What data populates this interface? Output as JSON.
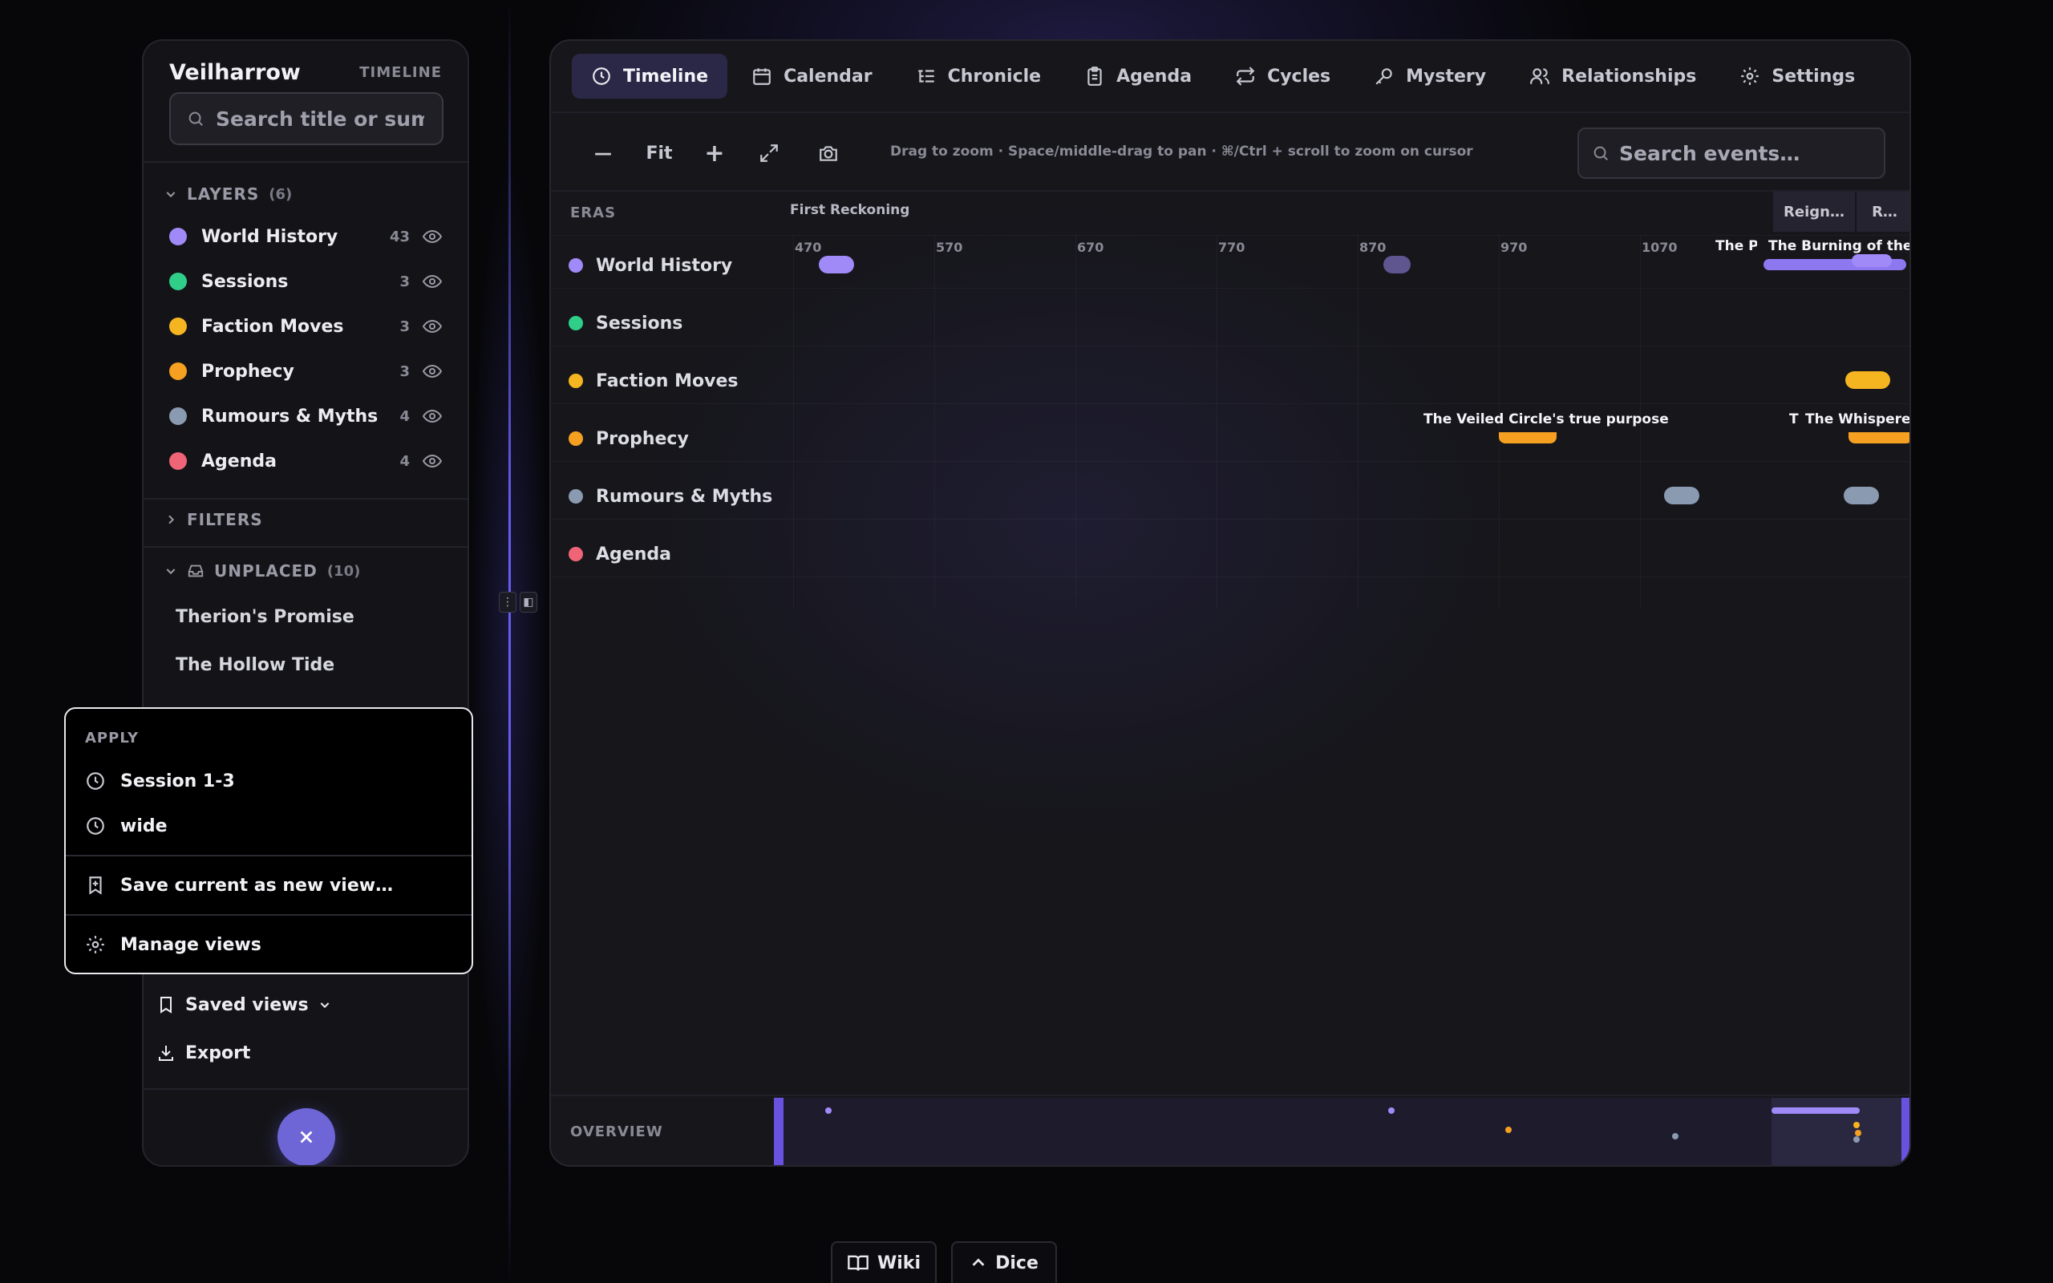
{
  "sidebar": {
    "title": "Veilharrow",
    "subtitle": "TIMELINE",
    "search_placeholder": "Search title or summary",
    "layers_heading": "LAYERS",
    "layers_count": "(6)",
    "layers": [
      {
        "name": "World History",
        "count": "43",
        "color": "#a08af8"
      },
      {
        "name": "Sessions",
        "count": "3",
        "color": "#2fcf8a"
      },
      {
        "name": "Faction Moves",
        "count": "3",
        "color": "#f5b520"
      },
      {
        "name": "Prophecy",
        "count": "3",
        "color": "#f5a020"
      },
      {
        "name": "Rumours & Myths",
        "count": "4",
        "color": "#8a9ab0"
      },
      {
        "name": "Agenda",
        "count": "4",
        "color": "#f06478"
      }
    ],
    "filters_heading": "FILTERS",
    "unplaced_heading": "UNPLACED",
    "unplaced_count": "(10)",
    "unplaced_items": [
      "Therion's Promise",
      "The Hollow Tide"
    ],
    "saved_views_label": "Saved views",
    "export_label": "Export"
  },
  "popup": {
    "apply_label": "APPLY",
    "views": [
      "Session 1-3",
      "wide"
    ],
    "save_label": "Save current as new view…",
    "manage_label": "Manage views"
  },
  "tabs": [
    "Timeline",
    "Calendar",
    "Chronicle",
    "Agenda",
    "Cycles",
    "Mystery",
    "Relationships",
    "Settings"
  ],
  "toolbar": {
    "zoom_out": "—",
    "fit": "Fit",
    "zoom_in": "+",
    "hint": "Drag to zoom · Space/middle-drag to pan · ⌘/Ctrl + scroll to zoom on cursor",
    "search_placeholder": "Search events…"
  },
  "timeline": {
    "eras_label": "ERAS",
    "eras": [
      "First Reckoning",
      "Reign…",
      "R…"
    ],
    "ticks": [
      "470",
      "570",
      "670",
      "770",
      "870",
      "970",
      "1070"
    ],
    "lanes": [
      "World History",
      "Sessions",
      "Faction Moves",
      "Prophecy",
      "Rumours & Myths",
      "Agenda"
    ],
    "event_labels": {
      "wh_1": "The Pl",
      "wh_2": "The Burning of the Sa",
      "pr_1": "The Veiled Circle's true purpose",
      "pr_2": "T",
      "pr_3": "The Whispered"
    },
    "overview_label": "OVERVIEW"
  },
  "dock": {
    "wiki": "Wiki",
    "dice": "Dice"
  },
  "colors": {
    "accent": "#6e66d6",
    "active_tab": "#2a2846"
  }
}
